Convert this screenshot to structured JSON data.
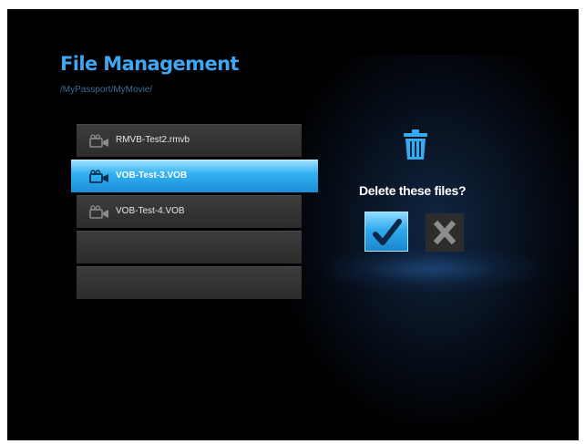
{
  "header": {
    "title": "File Management",
    "path": "/MyPassport/MyMovie/"
  },
  "file_list": {
    "items": [
      {
        "name": "RMVB-Test2.rmvb",
        "selected": false,
        "icon": "video-camera-icon"
      },
      {
        "name": "VOB-Test-3.VOB",
        "selected": true,
        "icon": "video-camera-icon"
      },
      {
        "name": "VOB-Test-4.VOB",
        "selected": false,
        "icon": "video-camera-icon"
      },
      {
        "name": "",
        "selected": false
      },
      {
        "name": "",
        "selected": false
      }
    ]
  },
  "dialog": {
    "icon": "trash-icon",
    "prompt": "Delete these files?",
    "confirm_icon": "checkmark-icon",
    "cancel_icon": "x-icon"
  },
  "colors": {
    "title": "#40a6f2",
    "selection": "#33b3f2",
    "background": "#000000"
  }
}
